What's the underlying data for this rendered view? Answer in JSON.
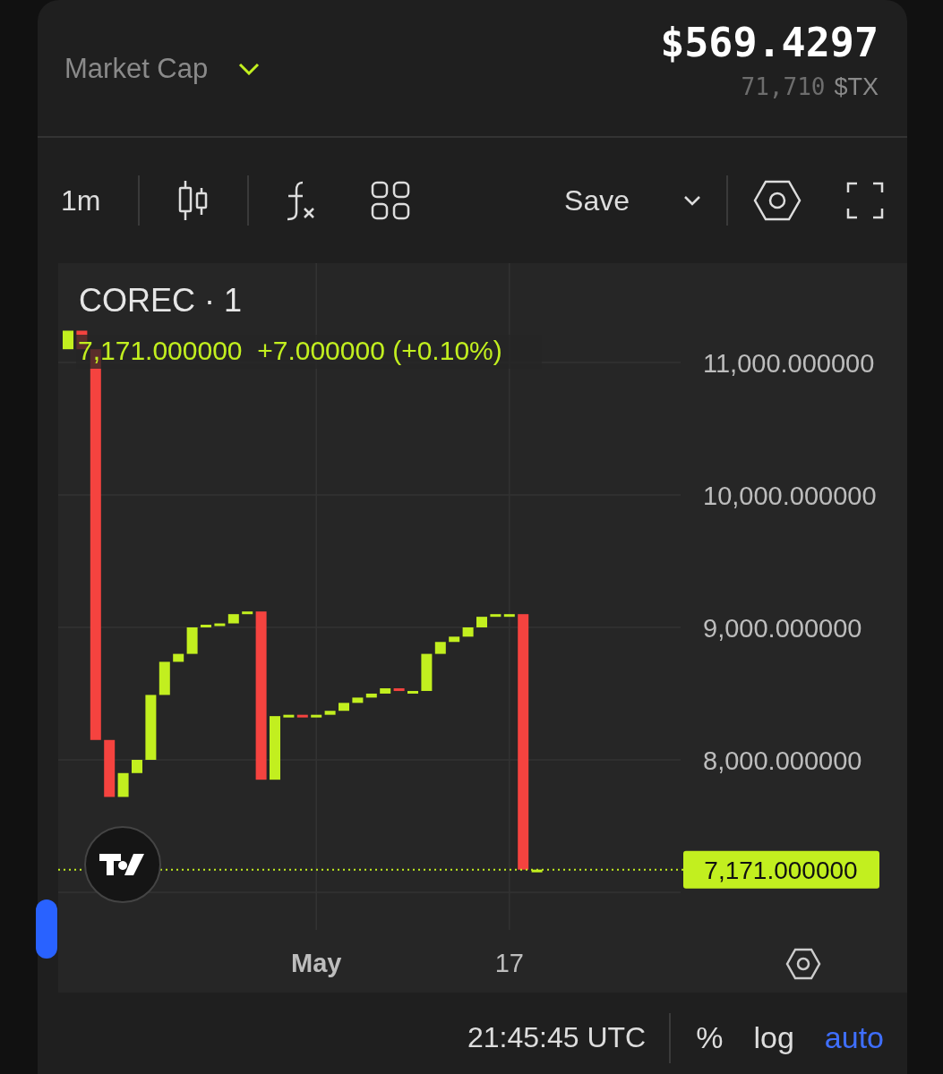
{
  "header": {
    "metric": "Market Cap",
    "price": "$569.4297",
    "balance_amount": "71,710",
    "balance_unit": "$TX"
  },
  "toolbar": {
    "interval": "1m",
    "save": "Save"
  },
  "chart": {
    "symbol": "COREC · 1",
    "legend_price": "7,171.000000",
    "legend_change": "+7.000000 (+0.10%)",
    "last_price_label": "7,171.000000",
    "price_axis_labels": [
      "11,000.000000",
      "10,000.000000",
      "9,000.000000",
      "8,000.000000"
    ],
    "time_axis_labels": [
      "May",
      "17"
    ]
  },
  "footer": {
    "time": "21:45:45 UTC",
    "buttons": [
      {
        "label": "%",
        "selected": false
      },
      {
        "label": "log",
        "selected": false
      },
      {
        "label": "auto",
        "selected": true
      }
    ]
  }
}
